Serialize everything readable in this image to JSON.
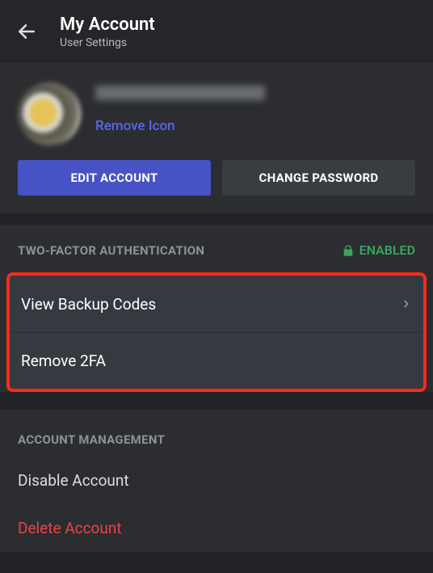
{
  "header": {
    "title": "My Account",
    "subtitle": "User Settings"
  },
  "profile": {
    "remove_icon_label": "Remove Icon"
  },
  "buttons": {
    "edit": "EDIT ACCOUNT",
    "change_password": "CHANGE PASSWORD"
  },
  "tfa": {
    "section_title": "TWO-FACTOR AUTHENTICATION",
    "status": "ENABLED",
    "view_backup": "View Backup Codes",
    "remove": "Remove 2FA"
  },
  "mgmt": {
    "section_title": "ACCOUNT MANAGEMENT",
    "disable": "Disable Account",
    "delete": "Delete Account"
  }
}
